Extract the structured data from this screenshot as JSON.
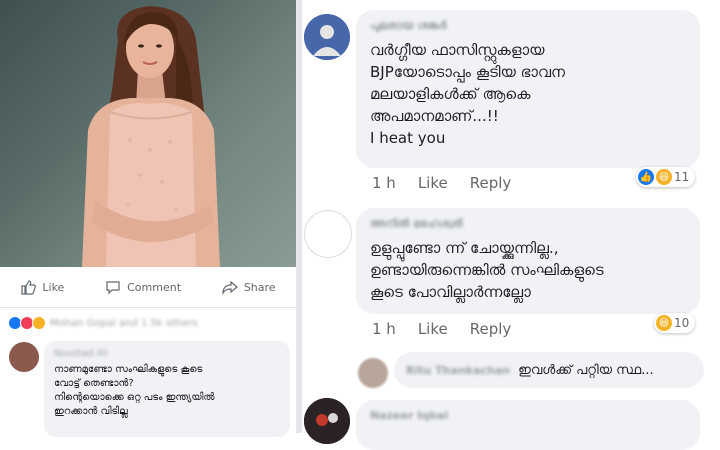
{
  "left_post": {
    "actions": {
      "like": "Like",
      "comment": "Comment",
      "share": "Share"
    },
    "reactions_summary": "Mohan Gopal and 1.5k others",
    "comment": {
      "author": "Noushad Ali",
      "lines": [
        "നാണമുണ്ടോ സംഘികളുടെ കൂടെ",
        "വോട്ട് തെണ്ടാൻ?",
        "നിന്റെയൊക്കെ ഒറ്റ പടം ഇന്ത്യയിൽ",
        "ഇറക്കാൻ വിടില്ല"
      ]
    }
  },
  "comments": [
    {
      "author": "പുലരായ ശങ്കർ",
      "lines": [
        "വർഗ്ഗീയ ഫാസിസ്റ്റുകളായ",
        "BJPയോടൊപ്പം കൂടിയ ഭാവന",
        "മലയാളികൾക്ക് ആകെ",
        "അപമാനമാണ്...!!",
        "I heat you"
      ],
      "time": "1 h",
      "like": "Like",
      "reply": "Reply",
      "reaction_count": "11"
    },
    {
      "author": "അനിൽ മഹേശ്വരി",
      "lines": [
        "ഉളുപ്പുണ്ടോ ന്ന് ചോയ്ക്കുന്നില്ല.,",
        "ഉണ്ടായിരുന്നെങ്കിൽ സംഘികളുടെ",
        "കൂടെ പോവില്ലാർന്നല്ലോ"
      ],
      "time": "1 h",
      "like": "Like",
      "reply": "Reply",
      "reaction_count": "10"
    },
    {
      "author": "Ritu Thankachan",
      "lines": [
        "ഇവൾക്ക് പറ്റിയ സ്ഥ..."
      ]
    },
    {
      "author": "Nazeer Iqbal",
      "lines": []
    }
  ],
  "colors": {
    "like_blue": "#1877f2",
    "haha_yellow": "#f7b125",
    "love_red": "#f33e58",
    "bubble_gray": "#f0f2f5"
  }
}
